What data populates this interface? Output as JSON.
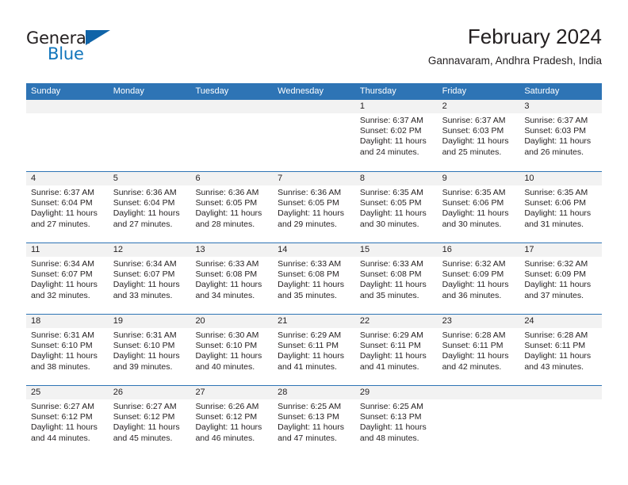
{
  "brand": {
    "name_top": "General",
    "name_bottom": "Blue",
    "accent_color": "#1175bb",
    "triangle_color": "#1064a8"
  },
  "header": {
    "title": "February 2024",
    "subtitle": "Gannavaram, Andhra Pradesh, India"
  },
  "theme": {
    "header_blue": "#2e74b5",
    "day_band_gray": "#f2f2f2",
    "text_color": "#231f20"
  },
  "calendar": {
    "weekday_headers": [
      "Sunday",
      "Monday",
      "Tuesday",
      "Wednesday",
      "Thursday",
      "Friday",
      "Saturday"
    ],
    "weeks": [
      [
        {
          "day": "",
          "empty": true
        },
        {
          "day": "",
          "empty": true
        },
        {
          "day": "",
          "empty": true
        },
        {
          "day": "",
          "empty": true
        },
        {
          "day": "1",
          "sunrise": "Sunrise: 6:37 AM",
          "sunset": "Sunset: 6:02 PM",
          "daylight_1": "Daylight: 11 hours",
          "daylight_2": "and 24 minutes."
        },
        {
          "day": "2",
          "sunrise": "Sunrise: 6:37 AM",
          "sunset": "Sunset: 6:03 PM",
          "daylight_1": "Daylight: 11 hours",
          "daylight_2": "and 25 minutes."
        },
        {
          "day": "3",
          "sunrise": "Sunrise: 6:37 AM",
          "sunset": "Sunset: 6:03 PM",
          "daylight_1": "Daylight: 11 hours",
          "daylight_2": "and 26 minutes."
        }
      ],
      [
        {
          "day": "4",
          "sunrise": "Sunrise: 6:37 AM",
          "sunset": "Sunset: 6:04 PM",
          "daylight_1": "Daylight: 11 hours",
          "daylight_2": "and 27 minutes."
        },
        {
          "day": "5",
          "sunrise": "Sunrise: 6:36 AM",
          "sunset": "Sunset: 6:04 PM",
          "daylight_1": "Daylight: 11 hours",
          "daylight_2": "and 27 minutes."
        },
        {
          "day": "6",
          "sunrise": "Sunrise: 6:36 AM",
          "sunset": "Sunset: 6:05 PM",
          "daylight_1": "Daylight: 11 hours",
          "daylight_2": "and 28 minutes."
        },
        {
          "day": "7",
          "sunrise": "Sunrise: 6:36 AM",
          "sunset": "Sunset: 6:05 PM",
          "daylight_1": "Daylight: 11 hours",
          "daylight_2": "and 29 minutes."
        },
        {
          "day": "8",
          "sunrise": "Sunrise: 6:35 AM",
          "sunset": "Sunset: 6:05 PM",
          "daylight_1": "Daylight: 11 hours",
          "daylight_2": "and 30 minutes."
        },
        {
          "day": "9",
          "sunrise": "Sunrise: 6:35 AM",
          "sunset": "Sunset: 6:06 PM",
          "daylight_1": "Daylight: 11 hours",
          "daylight_2": "and 30 minutes."
        },
        {
          "day": "10",
          "sunrise": "Sunrise: 6:35 AM",
          "sunset": "Sunset: 6:06 PM",
          "daylight_1": "Daylight: 11 hours",
          "daylight_2": "and 31 minutes."
        }
      ],
      [
        {
          "day": "11",
          "sunrise": "Sunrise: 6:34 AM",
          "sunset": "Sunset: 6:07 PM",
          "daylight_1": "Daylight: 11 hours",
          "daylight_2": "and 32 minutes."
        },
        {
          "day": "12",
          "sunrise": "Sunrise: 6:34 AM",
          "sunset": "Sunset: 6:07 PM",
          "daylight_1": "Daylight: 11 hours",
          "daylight_2": "and 33 minutes."
        },
        {
          "day": "13",
          "sunrise": "Sunrise: 6:33 AM",
          "sunset": "Sunset: 6:08 PM",
          "daylight_1": "Daylight: 11 hours",
          "daylight_2": "and 34 minutes."
        },
        {
          "day": "14",
          "sunrise": "Sunrise: 6:33 AM",
          "sunset": "Sunset: 6:08 PM",
          "daylight_1": "Daylight: 11 hours",
          "daylight_2": "and 35 minutes."
        },
        {
          "day": "15",
          "sunrise": "Sunrise: 6:33 AM",
          "sunset": "Sunset: 6:08 PM",
          "daylight_1": "Daylight: 11 hours",
          "daylight_2": "and 35 minutes."
        },
        {
          "day": "16",
          "sunrise": "Sunrise: 6:32 AM",
          "sunset": "Sunset: 6:09 PM",
          "daylight_1": "Daylight: 11 hours",
          "daylight_2": "and 36 minutes."
        },
        {
          "day": "17",
          "sunrise": "Sunrise: 6:32 AM",
          "sunset": "Sunset: 6:09 PM",
          "daylight_1": "Daylight: 11 hours",
          "daylight_2": "and 37 minutes."
        }
      ],
      [
        {
          "day": "18",
          "sunrise": "Sunrise: 6:31 AM",
          "sunset": "Sunset: 6:10 PM",
          "daylight_1": "Daylight: 11 hours",
          "daylight_2": "and 38 minutes."
        },
        {
          "day": "19",
          "sunrise": "Sunrise: 6:31 AM",
          "sunset": "Sunset: 6:10 PM",
          "daylight_1": "Daylight: 11 hours",
          "daylight_2": "and 39 minutes."
        },
        {
          "day": "20",
          "sunrise": "Sunrise: 6:30 AM",
          "sunset": "Sunset: 6:10 PM",
          "daylight_1": "Daylight: 11 hours",
          "daylight_2": "and 40 minutes."
        },
        {
          "day": "21",
          "sunrise": "Sunrise: 6:29 AM",
          "sunset": "Sunset: 6:11 PM",
          "daylight_1": "Daylight: 11 hours",
          "daylight_2": "and 41 minutes."
        },
        {
          "day": "22",
          "sunrise": "Sunrise: 6:29 AM",
          "sunset": "Sunset: 6:11 PM",
          "daylight_1": "Daylight: 11 hours",
          "daylight_2": "and 41 minutes."
        },
        {
          "day": "23",
          "sunrise": "Sunrise: 6:28 AM",
          "sunset": "Sunset: 6:11 PM",
          "daylight_1": "Daylight: 11 hours",
          "daylight_2": "and 42 minutes."
        },
        {
          "day": "24",
          "sunrise": "Sunrise: 6:28 AM",
          "sunset": "Sunset: 6:11 PM",
          "daylight_1": "Daylight: 11 hours",
          "daylight_2": "and 43 minutes."
        }
      ],
      [
        {
          "day": "25",
          "sunrise": "Sunrise: 6:27 AM",
          "sunset": "Sunset: 6:12 PM",
          "daylight_1": "Daylight: 11 hours",
          "daylight_2": "and 44 minutes."
        },
        {
          "day": "26",
          "sunrise": "Sunrise: 6:27 AM",
          "sunset": "Sunset: 6:12 PM",
          "daylight_1": "Daylight: 11 hours",
          "daylight_2": "and 45 minutes."
        },
        {
          "day": "27",
          "sunrise": "Sunrise: 6:26 AM",
          "sunset": "Sunset: 6:12 PM",
          "daylight_1": "Daylight: 11 hours",
          "daylight_2": "and 46 minutes."
        },
        {
          "day": "28",
          "sunrise": "Sunrise: 6:25 AM",
          "sunset": "Sunset: 6:13 PM",
          "daylight_1": "Daylight: 11 hours",
          "daylight_2": "and 47 minutes."
        },
        {
          "day": "29",
          "sunrise": "Sunrise: 6:25 AM",
          "sunset": "Sunset: 6:13 PM",
          "daylight_1": "Daylight: 11 hours",
          "daylight_2": "and 48 minutes."
        },
        {
          "day": "",
          "empty": true
        },
        {
          "day": "",
          "empty": true
        }
      ]
    ]
  }
}
